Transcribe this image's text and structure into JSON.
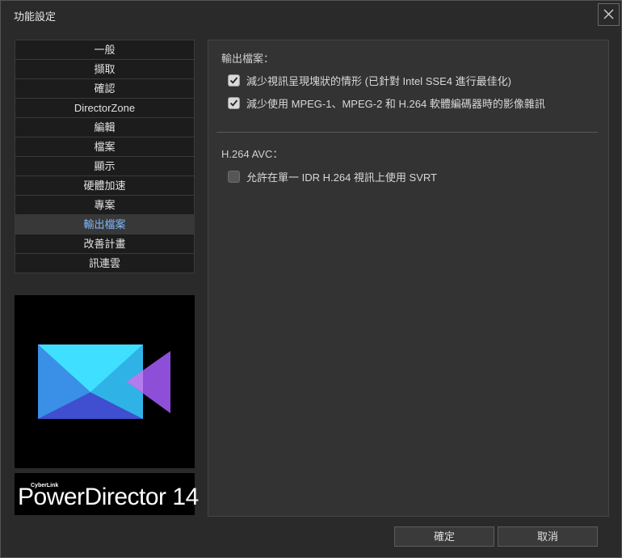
{
  "window": {
    "title": "功能設定",
    "close_icon": "close-icon"
  },
  "sidebar": {
    "items": [
      {
        "label": "一般"
      },
      {
        "label": "擷取"
      },
      {
        "label": "確認"
      },
      {
        "label": "DirectorZone"
      },
      {
        "label": "編輯"
      },
      {
        "label": "檔案"
      },
      {
        "label": "顯示"
      },
      {
        "label": "硬體加速"
      },
      {
        "label": "專案"
      },
      {
        "label": "輸出檔案",
        "active": true
      },
      {
        "label": "改善計畫"
      },
      {
        "label": "訊連雲"
      }
    ]
  },
  "branding": {
    "cyberlink": "CyberLink",
    "product": "PowerDirector 14"
  },
  "content": {
    "section1": {
      "title": "輸出檔案：",
      "options": [
        {
          "label": "減少視訊呈現塊狀的情形 (已針對 Intel SSE4 進行最佳化)",
          "checked": true
        },
        {
          "label": "減少使用 MPEG-1、MPEG-2 和 H.264 軟體編碼器時的影像雜訊",
          "checked": true
        }
      ]
    },
    "section2": {
      "title": "H.264 AVC：",
      "options": [
        {
          "label": "允許在單一 IDR H.264 視訊上使用 SVRT",
          "checked": false
        }
      ]
    }
  },
  "footer": {
    "ok_label": "確定",
    "cancel_label": "取消"
  },
  "colors": {
    "accent": "#7fb9ff",
    "background": "#2a2a2a",
    "panel": "#333333"
  }
}
